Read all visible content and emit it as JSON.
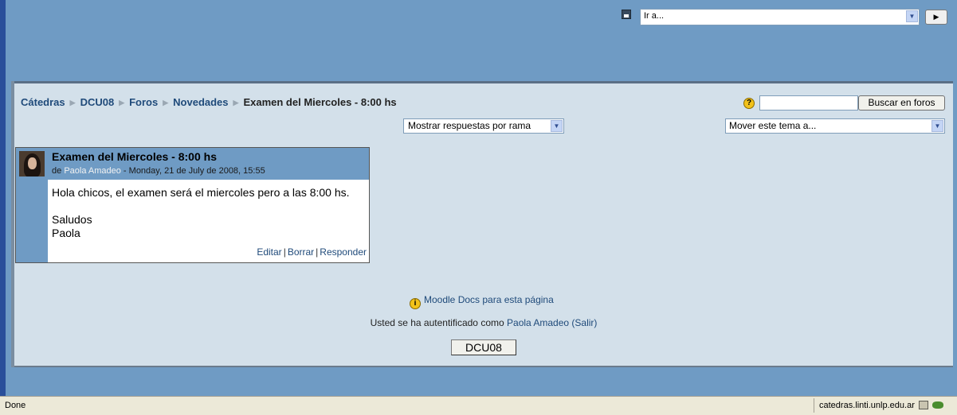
{
  "header": {
    "jump_menu": "Ir a...",
    "jump_go": "▶"
  },
  "breadcrumb": {
    "items": [
      "Cátedras",
      "DCU08",
      "Foros",
      "Novedades"
    ],
    "current": "Examen del Miercoles - 8:00 hs"
  },
  "search": {
    "value": "",
    "button": "Buscar en foros"
  },
  "display_mode": {
    "selected": "Mostrar respuestas por rama"
  },
  "move_topic": {
    "selected": "Mover este tema a..."
  },
  "post": {
    "title": "Examen del Miercoles - 8:00 hs",
    "by": "de",
    "author": "Paola Amadeo",
    "date": "Monday, 21 de July de 2008, 15:55",
    "body": [
      "Hola chicos, el examen será el miercoles pero a las 8:00 hs.",
      "",
      "Saludos",
      "Paola"
    ],
    "actions": [
      "Editar",
      "Borrar",
      "Responder"
    ]
  },
  "footer": {
    "docs_link": "Moodle Docs para esta página",
    "logged_in_prefix": "Usted se ha autentificado como",
    "user": "Paola Amadeo",
    "logout": "(Salir)",
    "course_button": "DCU08"
  },
  "statusbar": {
    "status": "Done",
    "domain": "catedras.linti.unlp.edu.ar"
  },
  "icons": {
    "save": "save-icon",
    "help": "help-icon",
    "info": "info-icon",
    "lock": "lock-icon",
    "network": "network-icon"
  }
}
